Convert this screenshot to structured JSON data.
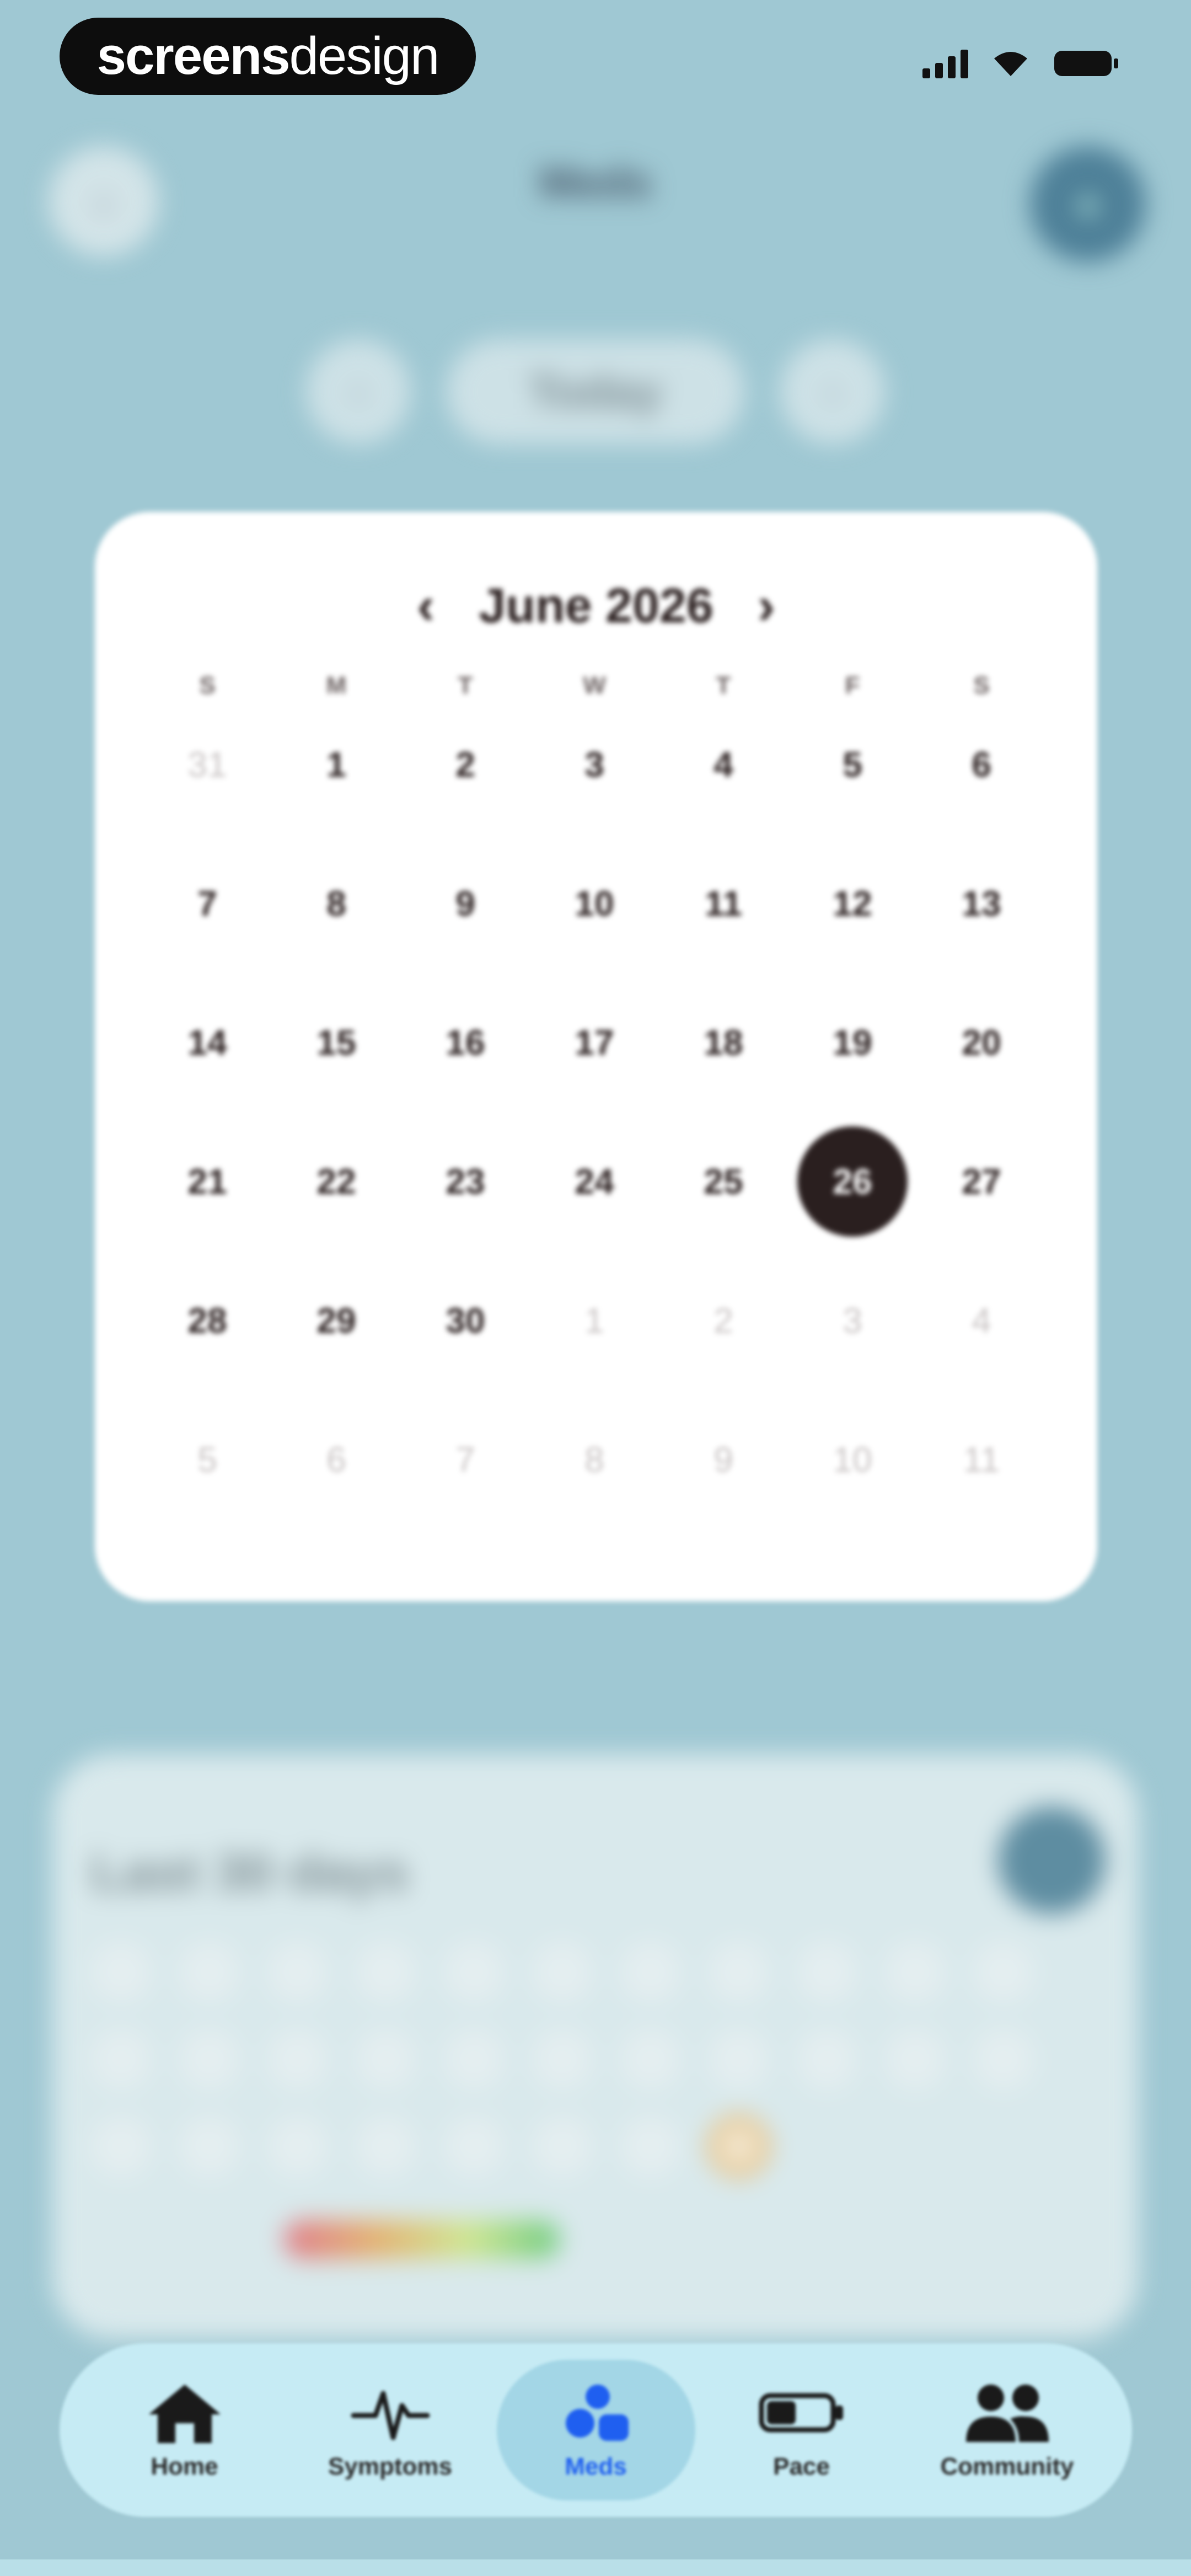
{
  "status_bar": {
    "brand_bold": "screens",
    "brand_light": "design"
  },
  "header": {
    "title": "Meds",
    "subtitle": "",
    "back_icon": "back-icon",
    "profile_icon": "profile-icon"
  },
  "day_nav": {
    "today_label": "Today",
    "prev_icon": "chevron-left-icon",
    "next_icon": "chevron-right-icon"
  },
  "calendar": {
    "month_label": "June 2026",
    "prev_label": "‹",
    "next_label": "›",
    "weekdays": [
      "S",
      "M",
      "T",
      "W",
      "T",
      "F",
      "S"
    ],
    "days": [
      {
        "label": "31",
        "muted": true
      },
      {
        "label": "1"
      },
      {
        "label": "2"
      },
      {
        "label": "3"
      },
      {
        "label": "4"
      },
      {
        "label": "5"
      },
      {
        "label": "6"
      },
      {
        "label": "7"
      },
      {
        "label": "8"
      },
      {
        "label": "9"
      },
      {
        "label": "10"
      },
      {
        "label": "11"
      },
      {
        "label": "12"
      },
      {
        "label": "13"
      },
      {
        "label": "14"
      },
      {
        "label": "15"
      },
      {
        "label": "16"
      },
      {
        "label": "17"
      },
      {
        "label": "18"
      },
      {
        "label": "19"
      },
      {
        "label": "20"
      },
      {
        "label": "21"
      },
      {
        "label": "22"
      },
      {
        "label": "23"
      },
      {
        "label": "24"
      },
      {
        "label": "25"
      },
      {
        "label": "26",
        "selected": true
      },
      {
        "label": "27"
      },
      {
        "label": "28"
      },
      {
        "label": "29"
      },
      {
        "label": "30"
      },
      {
        "label": "1",
        "muted": true
      },
      {
        "label": "2",
        "muted": true
      },
      {
        "label": "3",
        "muted": true
      },
      {
        "label": "4",
        "muted": true
      },
      {
        "label": "5",
        "muted": true
      },
      {
        "label": "6",
        "muted": true
      },
      {
        "label": "7",
        "muted": true
      },
      {
        "label": "8",
        "muted": true
      },
      {
        "label": "9",
        "muted": true
      },
      {
        "label": "10",
        "muted": true
      },
      {
        "label": "11",
        "muted": true
      }
    ],
    "selected_color": "#2a1f1f"
  },
  "history_card": {
    "eyebrow": "",
    "title": "Last 30 days",
    "legend_left": "",
    "legend_right": ""
  },
  "tab_bar": {
    "tabs": [
      {
        "label": "Home",
        "icon": "home-icon",
        "active": false
      },
      {
        "label": "Symptoms",
        "icon": "pulse-icon",
        "active": false
      },
      {
        "label": "Meds",
        "icon": "pills-icon",
        "active": true
      },
      {
        "label": "Pace",
        "icon": "battery-icon",
        "active": false
      },
      {
        "label": "Community",
        "icon": "people-icon",
        "active": false
      }
    ],
    "active_color": "#1f5ff0"
  },
  "colors": {
    "background": "#9fc8d3",
    "card": "#ffffff",
    "tab_bar": "#c6ebf4"
  }
}
